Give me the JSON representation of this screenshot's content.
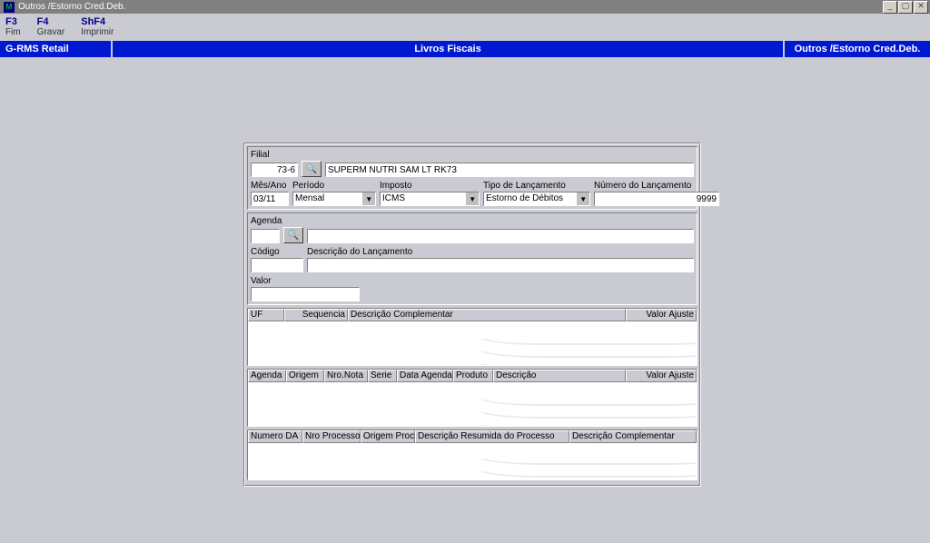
{
  "window": {
    "title": "Outros /Estorno Cred.Deb.",
    "icon_letter": "M"
  },
  "win_buttons": {
    "min": "_",
    "max": "▢",
    "close": "✕"
  },
  "menu": [
    {
      "shortcut": "F3",
      "label": "Fim"
    },
    {
      "shortcut": "F4",
      "label": "Gravar"
    },
    {
      "shortcut": "ShF4",
      "label": "Imprimir"
    }
  ],
  "sections": {
    "left": "G-RMS Retail",
    "mid": "Livros Fiscais",
    "right": "Outros /Estorno Cred.Deb."
  },
  "labels": {
    "filial": "Filial",
    "mes_ano": "Mês/Ano",
    "periodo": "Período",
    "imposto": "Imposto",
    "tipo_lanc": "Tipo de Lançamento",
    "num_lanc": "Número do Lançamento",
    "agenda": "Agenda",
    "cod_fiscal": "Código Fiscal",
    "desc_lanc": "Descrição do Lançamento",
    "valor": "Valor"
  },
  "values": {
    "filial": "73-6",
    "filial_desc": "SUPERM NUTRI SAM LT RK73",
    "mes_ano": "03/11",
    "periodo": "Mensal",
    "imposto": "ICMS",
    "tipo_lanc": "Estorno de Débitos",
    "num_lanc": "9999",
    "agenda": "",
    "cod_fiscal": "",
    "desc_lanc": "",
    "valor": ""
  },
  "icons": {
    "binoculars": "🔍",
    "dropdown": "▼"
  },
  "grid1": {
    "headers": [
      "UF",
      "Sequencia",
      "Descrição Complementar",
      "Valor Ajuste"
    ]
  },
  "grid2": {
    "headers": [
      "Agenda",
      "Origem",
      "Nro.Nota",
      "Serie",
      "Data Agenda",
      "Produto",
      "Descrição",
      "Valor Ajuste"
    ]
  },
  "grid3": {
    "headers": [
      "Numero DA",
      "Nro Processo",
      "Origem Proc",
      "Descrição Resumida do Processo",
      "Descrição Complementar"
    ]
  }
}
